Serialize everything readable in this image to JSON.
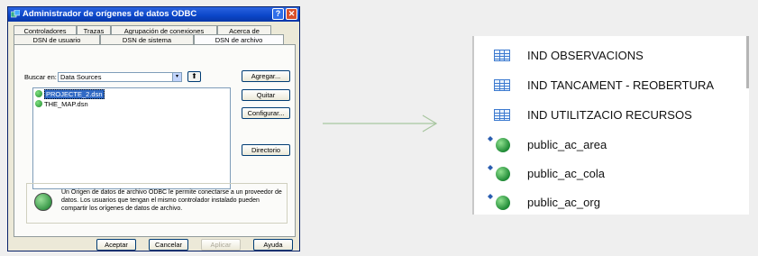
{
  "dialog": {
    "title": "Administrador de orígenes de datos ODBC",
    "tabs_row1": [
      "Controladores",
      "Trazas",
      "Agrupación de conexiones",
      "Acerca de"
    ],
    "tabs_row2": [
      "DSN de usuario",
      "DSN de sistema",
      "DSN de archivo"
    ],
    "search_label": "Buscar en:",
    "search_value": "Data Sources",
    "files": [
      "PROJECTE_2.dsn",
      "THE_MAP.dsn"
    ],
    "buttons": {
      "add": "Agregar...",
      "remove": "Quitar",
      "configure": "Configurar...",
      "directory": "Directorio"
    },
    "info_text": "Un Origen de datos de archivo ODBC le permite conectarse a un proveedor de datos. Los usuarios que tengan el mismo controlador instalado pueden compartir los orígenes de datos de archivo.",
    "footer": {
      "accept": "Aceptar",
      "cancel": "Cancelar",
      "apply": "Aplicar",
      "help": "Ayuda"
    },
    "help_glyph": "?",
    "close_glyph": "✕",
    "combo_arrow": "▾",
    "up_glyph": "⬆"
  },
  "catalog": {
    "items": [
      {
        "label": "IND OBSERVACIONS",
        "icon": "table-icon"
      },
      {
        "label": "IND TANCAMENT - REOBERTURA",
        "icon": "table-icon"
      },
      {
        "label": "IND UTILITZACIO RECURSOS",
        "icon": "table-icon"
      },
      {
        "label": "public_ac_area",
        "icon": "globe-icon"
      },
      {
        "label": "public_ac_cola",
        "icon": "globe-icon"
      },
      {
        "label": "public_ac_org",
        "icon": "globe-icon"
      }
    ]
  },
  "colors": {
    "title_blue": "#0a45c8",
    "selection": "#316ac5",
    "arrow": "#a8c6a0",
    "globe": "#1e8a35",
    "table": "#3c7ad0"
  }
}
